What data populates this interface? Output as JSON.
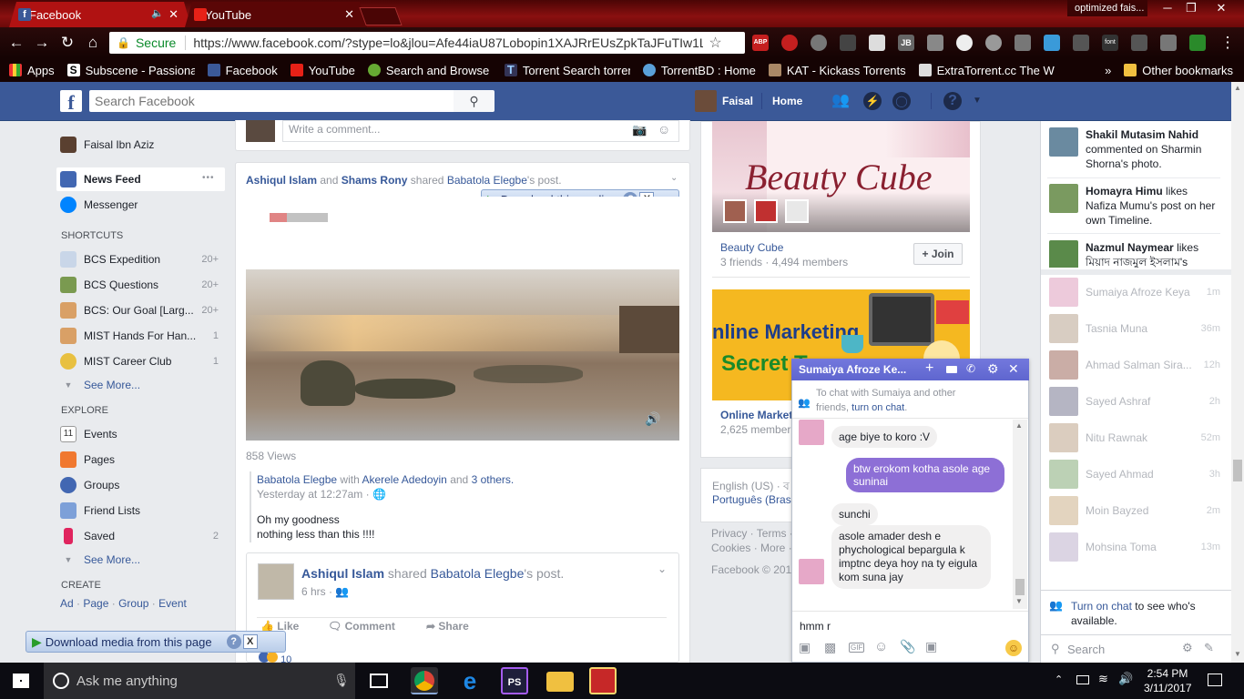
{
  "browser": {
    "tabs": [
      {
        "title": "Facebook",
        "active": true
      },
      {
        "title": "YouTube",
        "active": false
      }
    ],
    "profile": "optimized fais...",
    "window_controls": {
      "minimize": "─",
      "maximize": "❐",
      "close": "✕"
    },
    "address": {
      "secure_label": "Secure",
      "url": "https://www.facebook.com/?stype=lo&jlou=Afe44iaU87Lobopin1XAJRrEUsZpkTaJFuTIw1LlOzK"
    },
    "extensions": {
      "abp": "ABP",
      "jb": "JB",
      "font": "font"
    },
    "bookmarks": [
      "Apps",
      "Subscene - Passionate",
      "Facebook",
      "YouTube",
      "Search and Browse YI",
      "Torrent Search torrent",
      "TorrentBD : Home",
      "KAT - Kickass Torrents",
      "ExtraTorrent.cc The W"
    ],
    "bookmarks_more": "»",
    "other_bookmarks": "Other bookmarks"
  },
  "fb_header": {
    "search_placeholder": "Search Facebook",
    "user": "Faisal",
    "home": "Home"
  },
  "left_nav": {
    "profile_name": "Faisal Ibn Aziz",
    "news_feed": "News Feed",
    "news_feed_more": "•••",
    "messenger": "Messenger",
    "shortcuts_header": "SHORTCUTS",
    "shortcuts": [
      {
        "label": "BCS Expedition",
        "count": "20+"
      },
      {
        "label": "BCS Questions",
        "count": "20+"
      },
      {
        "label": "BCS: Our Goal [Larg...",
        "count": "20+"
      },
      {
        "label": "MIST Hands For Han...",
        "count": "1"
      },
      {
        "label": "MIST Career Club",
        "count": "1"
      }
    ],
    "see_more": "See More...",
    "explore_header": "EXPLORE",
    "explore": [
      {
        "label": "Events",
        "count": "",
        "icon_text": "11"
      },
      {
        "label": "Pages",
        "count": "",
        "icon_text": ""
      },
      {
        "label": "Groups",
        "count": "",
        "icon_text": ""
      },
      {
        "label": "Friend Lists",
        "count": "",
        "icon_text": ""
      },
      {
        "label": "Saved",
        "count": "2",
        "icon_text": ""
      }
    ],
    "see_more2": "See More...",
    "create_header": "CREATE",
    "create_links": [
      "Ad",
      "Page",
      "Group",
      "Event"
    ],
    "create_sep": "·"
  },
  "feed": {
    "comment_placeholder": "Write a comment...",
    "post1": {
      "author1": "Ashiqul Islam",
      "and": "and",
      "author2": "Shams Rony",
      "shared": "shared",
      "source": "Babatola Elegbe",
      "source_suffix": "'s post.",
      "views": "858 Views",
      "inner_author": "Babatola Elegbe",
      "with": "with",
      "with_person": "Akerele Adedoyin",
      "and_others_prefix": "and",
      "others": "3 others.",
      "time": "Yesterday at 12:27am ·",
      "text1": "Oh my goodness",
      "text2": "nothing less than this !!!!"
    },
    "post2": {
      "author": "Ashiqul Islam",
      "shared": "shared",
      "source": "Babatola Elegbe",
      "source_suffix": "'s post.",
      "time": "6 hrs ·",
      "like": "Like",
      "comment": "Comment",
      "share": "Share",
      "reactions": "10"
    },
    "download_media": "Download this media",
    "download_page": "Download media from this page",
    "help": "?",
    "close": "X"
  },
  "right_col": {
    "group1": {
      "banner": "Beauty Cube",
      "name": "Beauty Cube",
      "meta": "3 friends · 4,494 members",
      "join": "+ Join"
    },
    "group2": {
      "banner1": "nline Marketing",
      "banner2": "Secret T",
      "name": "Online Market",
      "meta": "2,625 member"
    },
    "lang1": "English (US) · ব",
    "lang2": "Português (Bras",
    "footer1": "Privacy · Terms ·",
    "footer2": "Cookies · More ·",
    "footer3": "Facebook © 201"
  },
  "chat": {
    "name": "Sumaiya Afroze Ke...",
    "notice_pre": "To chat with Sumaiya and other friends,",
    "notice_link": "turn on chat",
    "notice_end": ".",
    "messages": [
      {
        "from": "them",
        "text": "age biye to koro :V"
      },
      {
        "from": "me",
        "text": "btw erokom kotha asole age suninai"
      },
      {
        "from": "them",
        "text": "sunchi"
      },
      {
        "from": "them",
        "text": "asole amader desh e phychological bepargula k imptnc deya hoy na ty eigula kom suna jay"
      }
    ],
    "input": "hmm r",
    "gif": "GIF"
  },
  "right_sidebar": {
    "ticker": [
      {
        "name": "Shakil Mutasim Nahid",
        "rest": "commented on Sharmin Shorna's photo."
      },
      {
        "name": "Homayra Himu",
        "rest": "likes Nafiza Mumu's post on her own Timeline."
      },
      {
        "name": "Nazmul Naymear",
        "rest": "likes মিয়াদ নাজমুল ইসলাম's"
      }
    ],
    "contacts": [
      {
        "name": "Sumaiya Afroze Keya",
        "time": "1m"
      },
      {
        "name": "Tasnia Muna",
        "time": "36m"
      },
      {
        "name": "Ahmad Salman Sira...",
        "time": "12h"
      },
      {
        "name": "Sayed Ashraf",
        "time": "2h"
      },
      {
        "name": "Nitu Rawnak",
        "time": "52m"
      },
      {
        "name": "Sayed Ahmad",
        "time": "3h"
      },
      {
        "name": "Moin Bayzed",
        "time": "2m"
      },
      {
        "name": "Mohsina Toma",
        "time": "13m"
      }
    ],
    "turn_on_chat": "Turn on chat",
    "turn_on_rest": "to see who's available.",
    "search": "Search"
  },
  "taskbar": {
    "cortana": "Ask me anything",
    "time": "2:54 PM",
    "date": "3/11/2017",
    "ps": "PS"
  },
  "colors": {
    "fb_blue": "#3b5998",
    "link": "#365899",
    "chat_header": "#6d74d8",
    "chat_me": "#8d6fd6",
    "chrome_red": "#8a1010"
  }
}
